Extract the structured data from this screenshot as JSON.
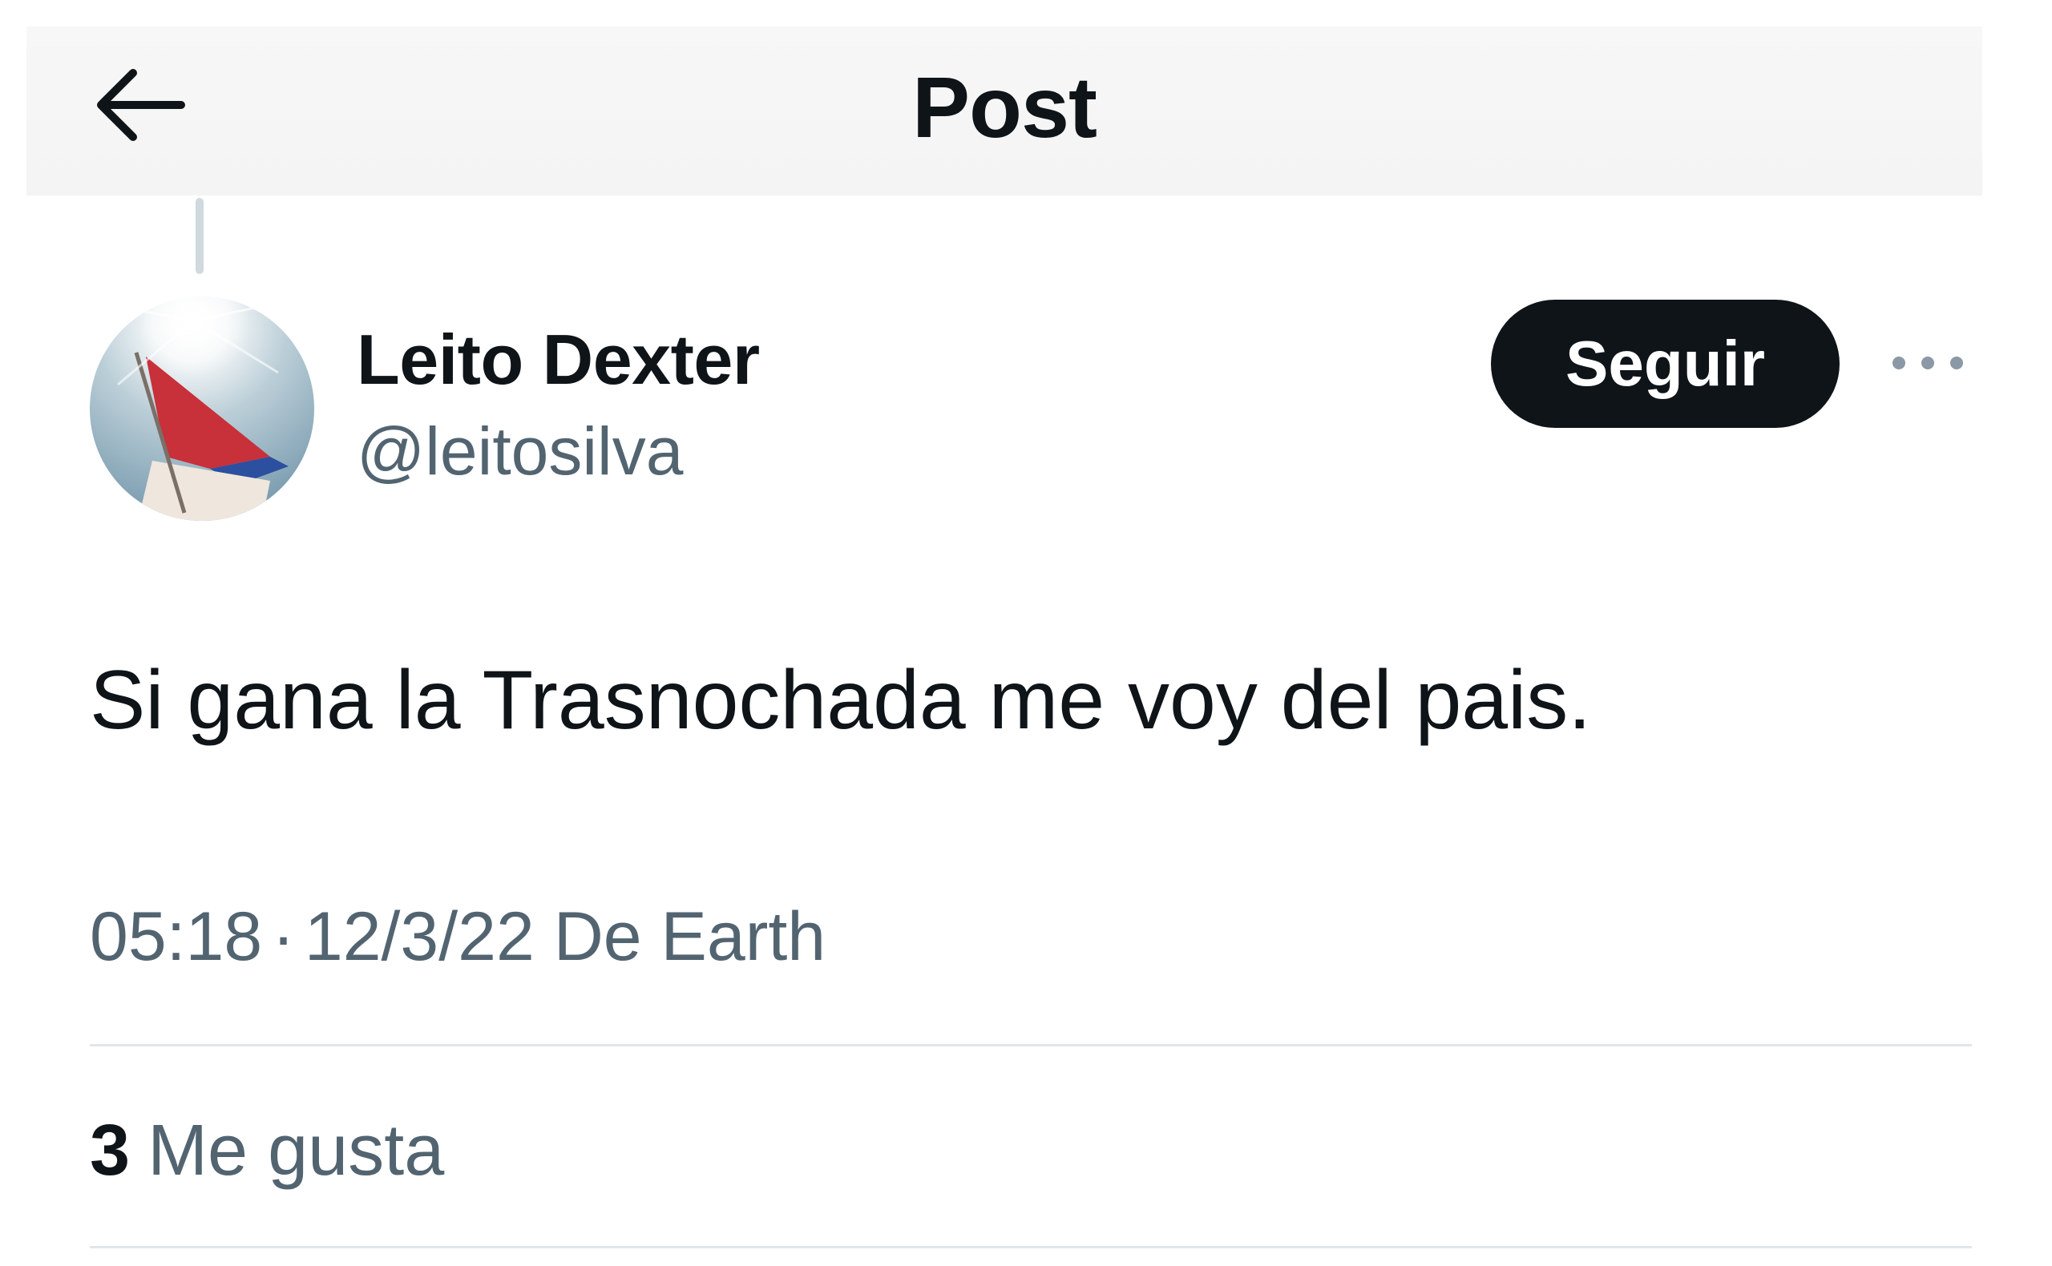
{
  "header": {
    "title": "Post",
    "back_icon": "arrow-left-icon"
  },
  "author": {
    "display_name": "Leito Dexter",
    "handle": "@leitosilva",
    "avatar": "flag-in-sunlight-avatar"
  },
  "actions": {
    "follow_label": "Seguir",
    "more_icon": "more-horizontal-icon"
  },
  "tweet": {
    "text": "Si gana la Trasnochada me voy del pais.",
    "time": "05:18",
    "separator": "·",
    "date": "12/3/22",
    "source": "De Earth"
  },
  "stats": {
    "likes_count": "3",
    "likes_label": "Me gusta"
  },
  "colors": {
    "text_primary": "#0f1419",
    "text_secondary": "#536471",
    "follow_bg": "#0f1419",
    "divider": "#e1e6ea"
  }
}
